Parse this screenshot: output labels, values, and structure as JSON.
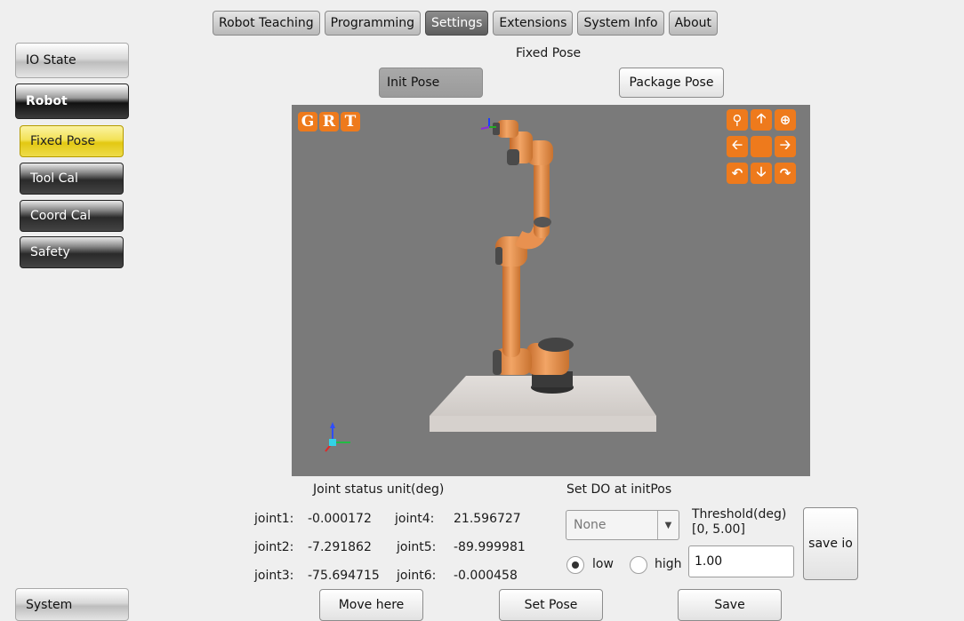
{
  "tabs": [
    {
      "label": "Robot Teaching",
      "active": false
    },
    {
      "label": "Programming",
      "active": false
    },
    {
      "label": "Settings",
      "active": true
    },
    {
      "label": "Extensions",
      "active": false
    },
    {
      "label": "System Info",
      "active": false
    },
    {
      "label": "About",
      "active": false
    }
  ],
  "sidebar": {
    "io_state": "IO State",
    "robot": "Robot",
    "items": [
      {
        "label": "Fixed Pose",
        "active": true
      },
      {
        "label": "Tool Cal",
        "active": false
      },
      {
        "label": "Coord Cal",
        "active": false
      },
      {
        "label": "Safety",
        "active": false
      }
    ],
    "system": "System"
  },
  "page_title": "Fixed Pose",
  "pose_buttons": {
    "init": "Init Pose",
    "package": "Package Pose"
  },
  "viewer": {
    "controls": [
      "G",
      "R",
      "T"
    ],
    "nav_icons": [
      "zoom-out",
      "arrow-up",
      "zoom-in",
      "arrow-left",
      "center",
      "arrow-right",
      "rotate-left",
      "arrow-down",
      "rotate-right"
    ],
    "accent": "#ee7a1c",
    "background": "#7a7a7a"
  },
  "joints": {
    "header": "Joint status unit(deg)",
    "joint1": {
      "label": "joint1:",
      "value": "-0.000172"
    },
    "joint2": {
      "label": "joint2:",
      "value": "-7.291862"
    },
    "joint3": {
      "label": "joint3:",
      "value": "-75.694715"
    },
    "joint4": {
      "label": "joint4:",
      "value": "21.596727"
    },
    "joint5": {
      "label": "joint5:",
      "value": "-89.999981"
    },
    "joint6": {
      "label": "joint6:",
      "value": "-0.000458"
    }
  },
  "do_settings": {
    "header": "Set DO at initPos",
    "select_value": "None",
    "threshold_label": "Threshold(deg)",
    "threshold_range": "[0, 5.00]",
    "radio_low": "low",
    "radio_high": "high",
    "selected_level": "low",
    "threshold_value": "1.00",
    "save_io": "save io"
  },
  "actions": {
    "move_here": "Move here",
    "set_pose": "Set Pose",
    "save": "Save"
  }
}
